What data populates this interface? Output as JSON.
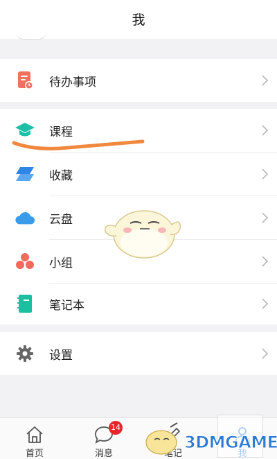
{
  "header": {
    "title": "我"
  },
  "menu": {
    "todo_label": "待办事项",
    "course_label": "课程",
    "favorites_label": "收藏",
    "cloud_label": "云盘",
    "group_label": "小组",
    "notebook_label": "笔记本",
    "settings_label": "设置"
  },
  "colors": {
    "todo_icon": "#f0715f",
    "course_icon": "#1dbfa6",
    "favorites_icon": "#2f86e8",
    "cloud_icon": "#3a9be8",
    "group_icon": "#f26b5c",
    "notebook_icon": "#1cbfa0",
    "settings_icon": "#666666",
    "annotation_stroke": "#f0883e",
    "badge": "#e7262b"
  },
  "tabbar": {
    "home_label": "首页",
    "messages_label": "消息",
    "messages_badge": "14",
    "notes_label": "笔记",
    "me_label": "我"
  },
  "watermark": {
    "text": "3DMGAME"
  }
}
